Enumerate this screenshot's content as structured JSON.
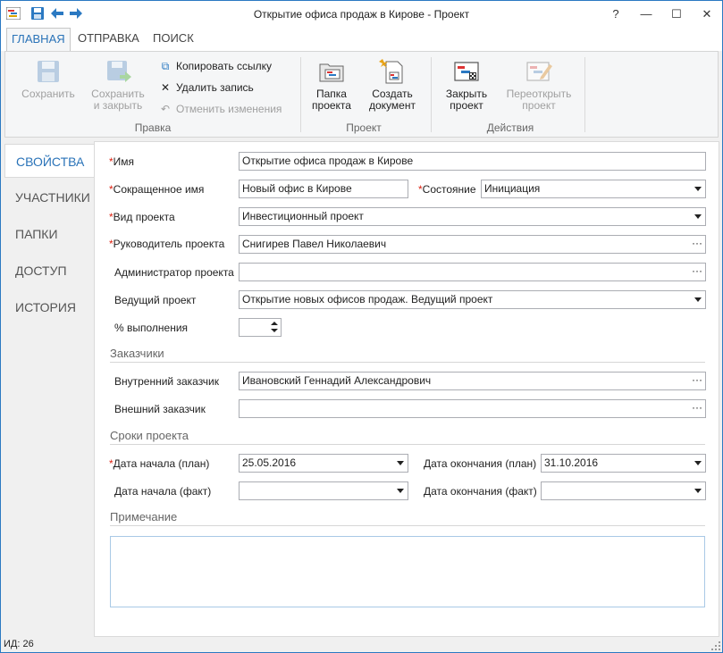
{
  "window": {
    "title": "Открытие офиса продаж в Кирове - Проект",
    "help": "?",
    "minimize": "—",
    "maximize": "☐",
    "close": "✕",
    "accent": "#2b79c2"
  },
  "ribbon_tabs": [
    "ГЛАВНАЯ",
    "ОТПРАВКА",
    "ПОИСК"
  ],
  "ribbon": {
    "edit_group": {
      "label": "Правка",
      "save": "Сохранить",
      "save_close_1": "Сохранить",
      "save_close_2": "и закрыть",
      "copy_link": "Копировать ссылку",
      "delete_record": "Удалить запись",
      "undo_changes": "Отменить изменения"
    },
    "project_group": {
      "label": "Проект",
      "folder_1": "Папка",
      "folder_2": "проекта",
      "create_doc_1": "Создать",
      "create_doc_2": "документ"
    },
    "actions_group": {
      "label": "Действия",
      "close_project_1": "Закрыть",
      "close_project_2": "проект",
      "reopen_project_1": "Переоткрыть",
      "reopen_project_2": "проект"
    }
  },
  "nav": [
    "СВОЙСТВА",
    "УЧАСТНИКИ",
    "ПАПКИ",
    "ДОСТУП",
    "ИСТОРИЯ"
  ],
  "form": {
    "required_mark": "*",
    "name_label": "Имя",
    "name_value": "Открытие офиса продаж в Кирове",
    "short_name_label": "Сокращенное имя",
    "short_name_value": "Новый офис в Кирове",
    "state_label": "Состояние",
    "state_value": "Инициация",
    "type_label": "Вид проекта",
    "type_value": "Инвестиционный проект",
    "manager_label": "Руководитель проекта",
    "manager_value": "Снигирев Павел Николаевич",
    "admin_label": "Администратор проекта",
    "admin_value": "",
    "lead_label": "Ведущий проект",
    "lead_value": "Открытие новых офисов продаж. Ведущий проект",
    "percent_label": "% выполнения",
    "percent_value": "",
    "customers_section": "Заказчики",
    "internal_label": "Внутренний заказчик",
    "internal_value": "Ивановский Геннадий Александрович",
    "external_label": "Внешний заказчик",
    "external_value": "",
    "dates_section": "Сроки проекта",
    "start_plan_label": "Дата начала (план)",
    "start_plan_value": "25.05.2016",
    "end_plan_label": "Дата окончания (план)",
    "end_plan_value": "31.10.2016",
    "start_fact_label": "Дата начала (факт)",
    "start_fact_value": "",
    "end_fact_label": "Дата окончания (факт)",
    "end_fact_value": "",
    "notes_section": "Примечание",
    "notes_value": "",
    "ellipsis": "···"
  },
  "status": {
    "id_text": "ИД: 26"
  }
}
